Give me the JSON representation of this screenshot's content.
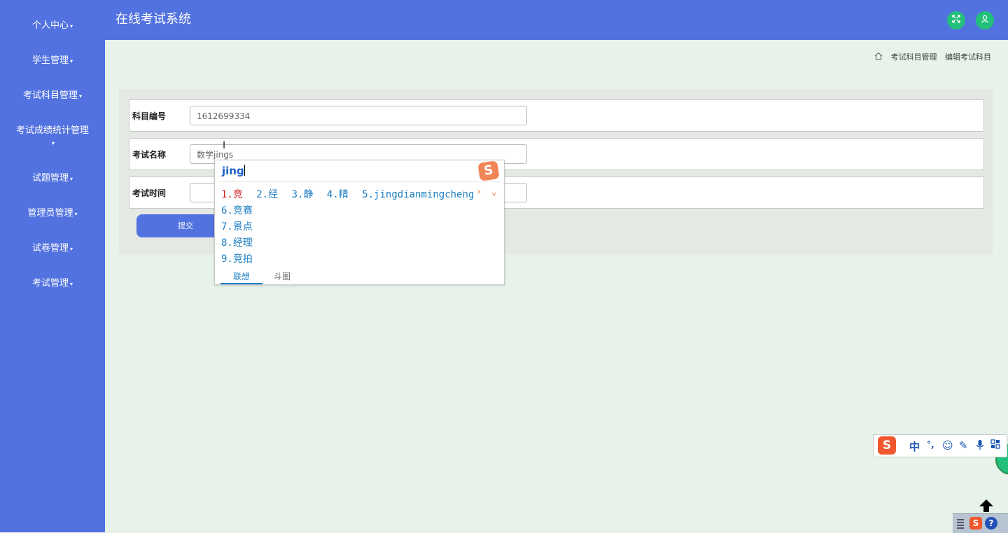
{
  "app": {
    "title": "在线考试系统"
  },
  "sidebar": {
    "items": [
      {
        "label": "个人中心"
      },
      {
        "label": "学生管理"
      },
      {
        "label": "考试科目管理"
      },
      {
        "label": "考试成绩统计管理"
      },
      {
        "label": "试题管理"
      },
      {
        "label": "管理员管理"
      },
      {
        "label": "试卷管理"
      },
      {
        "label": "考试管理"
      }
    ]
  },
  "header": {
    "icons": [
      "fullscreen-icon",
      "user-icon"
    ]
  },
  "breadcrumb": {
    "items": [
      "考试科目管理",
      "编辑考试科目"
    ]
  },
  "form": {
    "subject_code_label": "科目编号",
    "subject_code_value": "1612699334",
    "exam_name_label": "考试名称",
    "exam_name_value": "数学jings",
    "exam_time_label": "考试时间",
    "exam_time_value": "",
    "submit_label": "提交"
  },
  "ime": {
    "composition": "jing",
    "top_candidates": [
      "1.竞",
      "2.经",
      "3.静",
      "4.精",
      "5.jingdianmingcheng"
    ],
    "more_candidates": [
      "6.竞赛",
      "7.景点",
      "8.经理",
      "9.竞拍"
    ],
    "tabs": [
      "联想",
      "斗图"
    ]
  },
  "ime_toolbar": {
    "mode": "中",
    "punct": "°,"
  },
  "colors": {
    "sidebar": "#5272e0",
    "content_bg": "#e6f2ea",
    "accent_green": "#22c07a"
  }
}
